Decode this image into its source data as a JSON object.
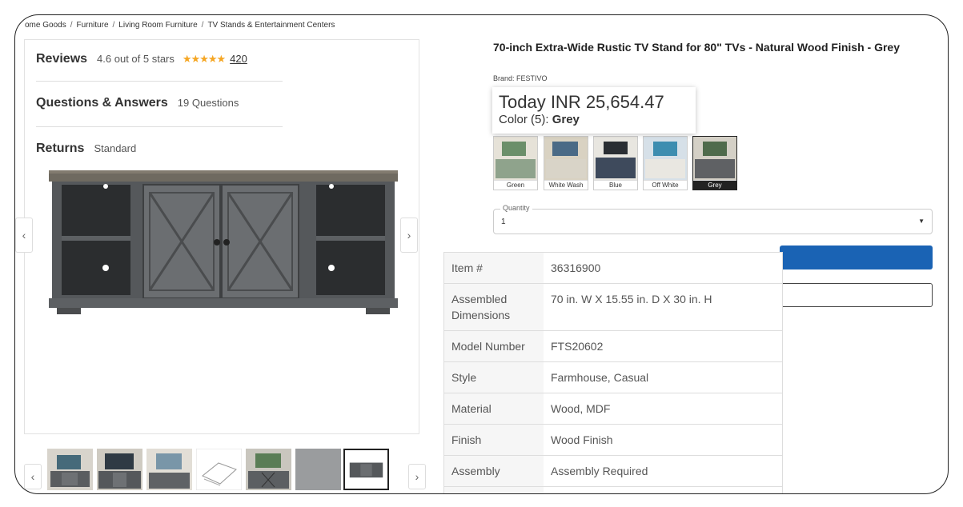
{
  "breadcrumb": [
    "ome Goods",
    "Furniture",
    "Living Room Furniture",
    "TV Stands & Entertainment Centers"
  ],
  "reviews": {
    "heading": "Reviews",
    "rating_text": "4.6 out of 5 stars",
    "stars": "★★★★★",
    "count": "420"
  },
  "qa": {
    "heading": "Questions & Answers",
    "count": "19 Questions"
  },
  "returns": {
    "heading": "Returns",
    "value": "Standard"
  },
  "nav": {
    "prev": "‹",
    "next": "›"
  },
  "product": {
    "title": "70-inch Extra-Wide Rustic TV Stand for 80\" TVs - Natural Wood Finish - Grey",
    "brand": "Brand: FESTIVO",
    "price": "Today INR 25,654.47",
    "color_label": "Color (5): ",
    "color_value": "Grey"
  },
  "swatches": [
    {
      "label": "Green",
      "color": "#8fa38c"
    },
    {
      "label": "White Wash",
      "color": "#d9d4c8"
    },
    {
      "label": "Blue",
      "color": "#3e4a5c"
    },
    {
      "label": "Off White",
      "color": "#e9e7e1"
    },
    {
      "label": "Grey",
      "color": "#5f6164"
    }
  ],
  "quantity": {
    "legend": "Quantity",
    "value": "1",
    "caret": "▼"
  },
  "specs": [
    {
      "key": "Item #",
      "value": "36316900"
    },
    {
      "key": "Assembled Dimensions",
      "value": "70 in. W X 15.55 in. D X 30 in. H"
    },
    {
      "key": "Model Number",
      "value": "FTS20602"
    },
    {
      "key": "Style",
      "value": "Farmhouse, Casual"
    },
    {
      "key": "Material",
      "value": "Wood, MDF"
    },
    {
      "key": "Finish",
      "value": "Wood Finish"
    },
    {
      "key": "Assembly",
      "value": "Assembly Required"
    }
  ],
  "colors": {
    "accent": "#1a63b4",
    "star": "#f5a623",
    "selected": "#222222"
  }
}
